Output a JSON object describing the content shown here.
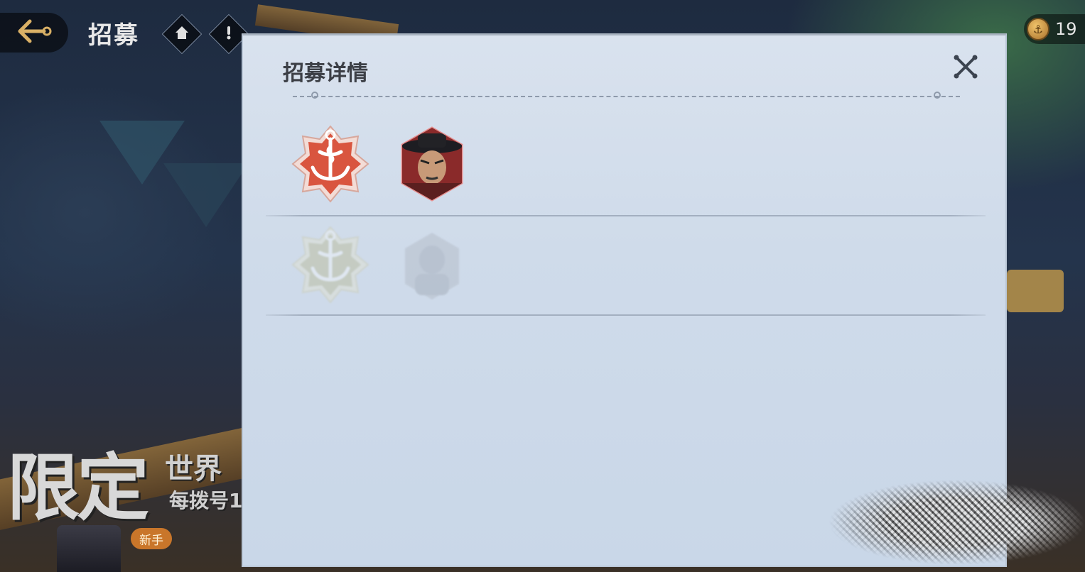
{
  "header": {
    "title": "招募",
    "back_icon": "arrow-back-icon",
    "home_icon": "home-icon",
    "info_icon": "exclamation-icon"
  },
  "currency": {
    "icon": "coin-icon",
    "value": "19"
  },
  "banner": {
    "big_text": "限定",
    "line1": "世界",
    "line2": "每拨号1",
    "badge": "新手"
  },
  "modal": {
    "title": "招募详情",
    "close_icon": "crossed-bones-close-icon",
    "rows": [
      {
        "rank_icon": "anchor-rank-icon",
        "rank_color": "#d9553f",
        "portrait": "character-portrait-mihawk",
        "faded": false
      },
      {
        "rank_icon": "anchor-rank-icon",
        "rank_color": "#b3b07a",
        "portrait": "character-portrait-silhouette",
        "faded": true
      }
    ]
  },
  "colors": {
    "modal_bg": "#d9e2ee",
    "title_text": "#3c3f46",
    "rank_red": "#d9553f",
    "coin_gold": "#f1c46b"
  }
}
